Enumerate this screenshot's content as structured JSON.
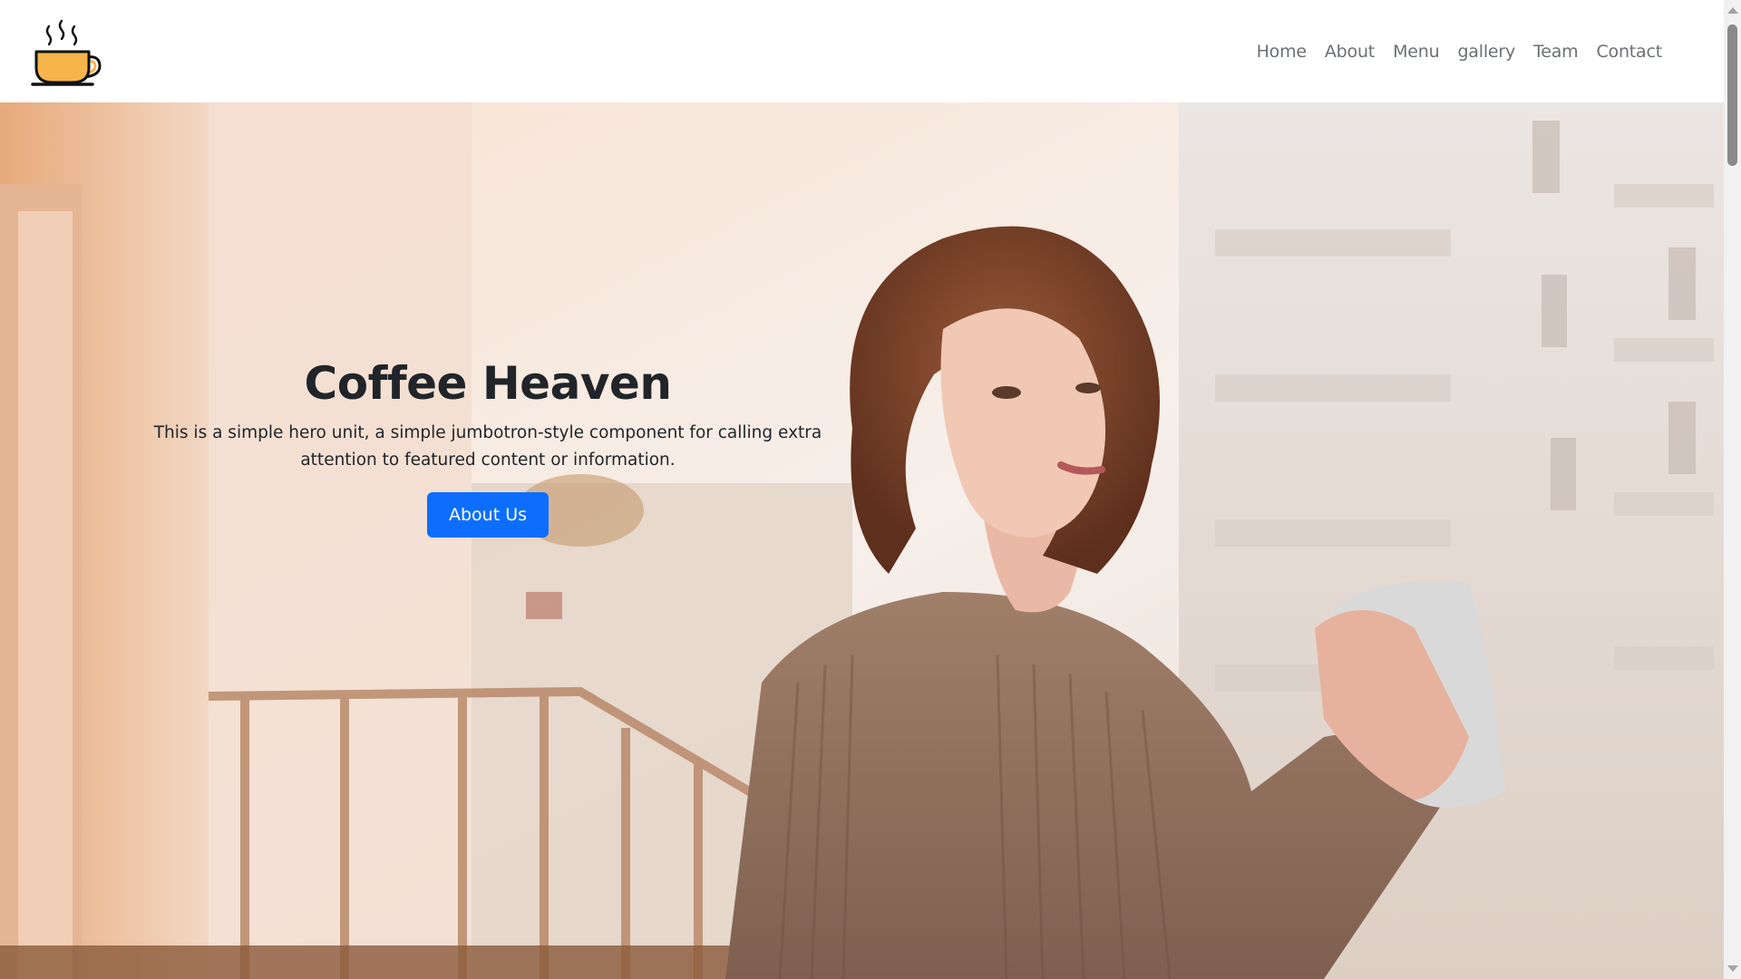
{
  "nav": {
    "logo_icon": "coffee-cup-icon",
    "links": [
      {
        "label": "Home"
      },
      {
        "label": "About"
      },
      {
        "label": "Menu"
      },
      {
        "label": "gallery"
      },
      {
        "label": "Team"
      },
      {
        "label": "Contact"
      }
    ]
  },
  "hero": {
    "title": "Coffee Heaven",
    "lead": "This is a simple hero unit, a simple jumbotron-style component for calling extra attention to featured content or information.",
    "button_label": "About Us",
    "background": "photo of a woman with a coffee mug on a balcony"
  },
  "colors": {
    "primary": "#0d6efd",
    "nav_text": "#6c6f73",
    "heading": "#212529",
    "cup": "#f6b44a"
  }
}
